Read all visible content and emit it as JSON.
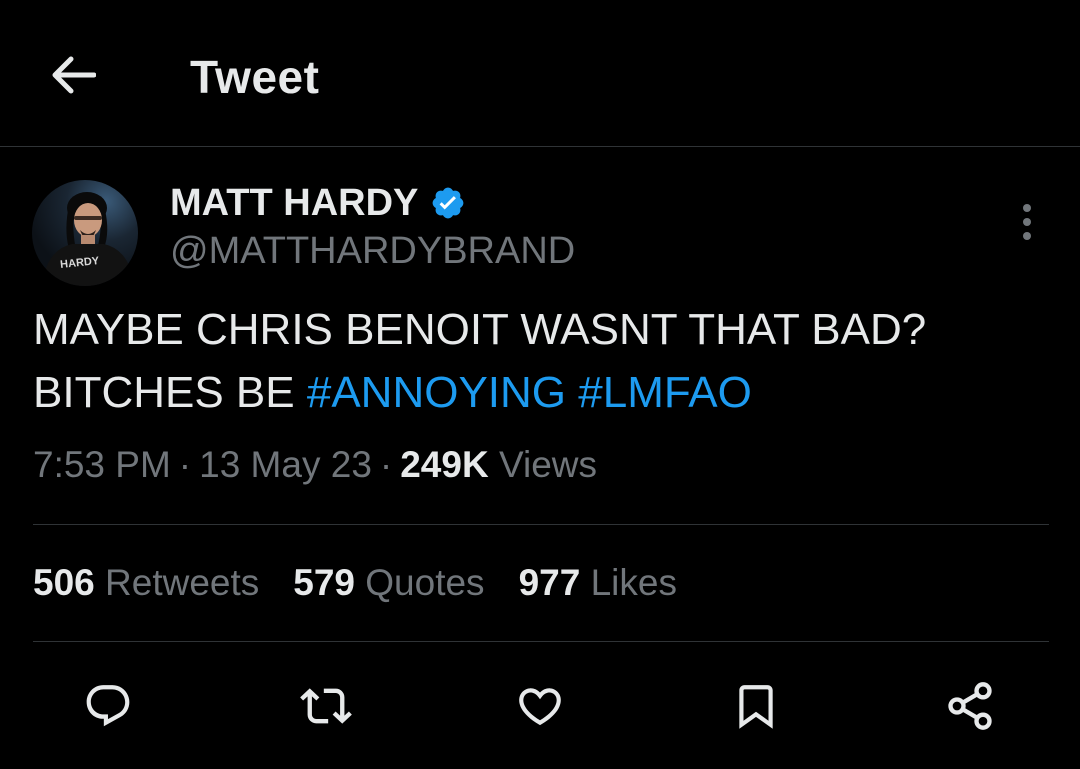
{
  "header": {
    "title": "Tweet",
    "back_icon": "arrow-left-icon"
  },
  "tweet": {
    "author": {
      "name": "MATT HARDY",
      "handle": "@MATTHARDYBRAND",
      "verified": true,
      "verified_color": "#1d9bf0",
      "avatar_shirt_text": "HARDY"
    },
    "text": {
      "line1": "MAYBE CHRIS BENOIT WASNT THAT BAD?",
      "line2_prefix": "BITCHES BE ",
      "hashtags": [
        "#ANNOYING",
        "#LMFAO"
      ]
    },
    "meta": {
      "time": "7:53 PM",
      "separator": "·",
      "date": "13 May 23",
      "views_count": "249K",
      "views_label": "Views"
    },
    "stats": {
      "retweets": {
        "count": "506",
        "label": "Retweets"
      },
      "quotes": {
        "count": "579",
        "label": "Quotes"
      },
      "likes": {
        "count": "977",
        "label": "Likes"
      }
    },
    "actions": [
      "reply-icon",
      "retweet-icon",
      "like-icon",
      "bookmark-icon",
      "share-icon"
    ]
  },
  "colors": {
    "background": "#000000",
    "text_primary": "#e7e9ea",
    "text_secondary": "#71767b",
    "accent": "#1d9bf0",
    "divider": "#2f3336"
  }
}
